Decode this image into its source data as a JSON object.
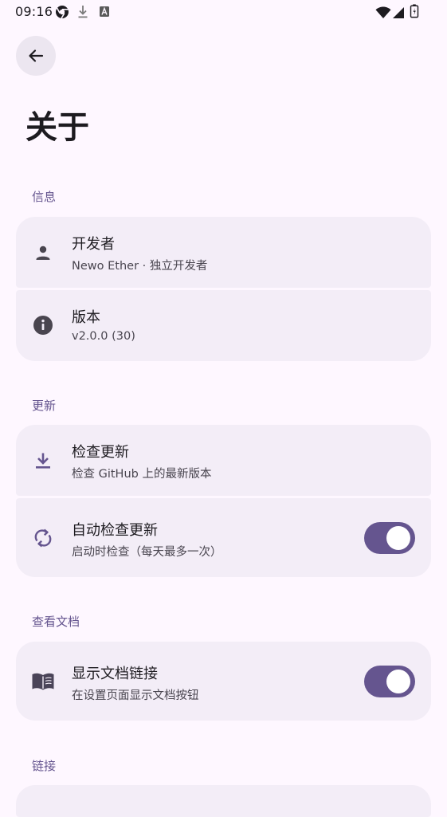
{
  "status_bar": {
    "time": "09:16",
    "icons": [
      "chrome-icon",
      "download-icon",
      "font-icon",
      "wifi-icon",
      "signal-icon",
      "battery-icon"
    ]
  },
  "header": {
    "back_icon": "arrow-back-icon",
    "title": "关于"
  },
  "sections": {
    "info": {
      "header": "信息",
      "developer": {
        "icon": "person-icon",
        "title": "开发者",
        "subtitle": "Newo Ether · 独立开发者"
      },
      "version": {
        "icon": "info-icon",
        "title": "版本",
        "subtitle": "v2.0.0 (30)"
      }
    },
    "update": {
      "header": "更新",
      "check": {
        "icon": "download-icon",
        "title": "检查更新",
        "subtitle": "检查 GitHub 上的最新版本"
      },
      "auto": {
        "icon": "sync-icon",
        "title": "自动检查更新",
        "subtitle": "启动时检查（每天最多一次）",
        "enabled": true
      }
    },
    "docs": {
      "header": "查看文档",
      "show_link": {
        "icon": "book-icon",
        "title": "显示文档链接",
        "subtitle": "在设置页面显示文档按钮",
        "enabled": true
      }
    },
    "links": {
      "header": "链接"
    }
  },
  "colors": {
    "background": "#FEF7FF",
    "card": "#F3EDF7",
    "accent": "#65558F",
    "on_surface": "#1D1B20",
    "on_surface_variant": "#49454F"
  }
}
